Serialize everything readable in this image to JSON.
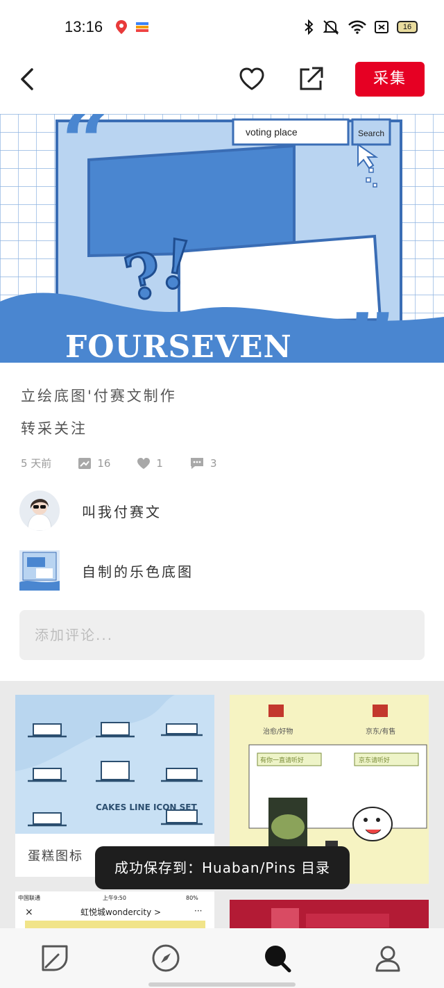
{
  "status_bar": {
    "time": "13:16",
    "battery": "16",
    "icons": [
      "app-notification-icon",
      "wallet-icon",
      "bluetooth-icon",
      "mute-icon",
      "wifi-icon",
      "sim-icon",
      "battery-icon"
    ]
  },
  "top_nav": {
    "collect_label": "采集",
    "icons": [
      "back-arrow-icon",
      "heart-icon",
      "share-icon"
    ]
  },
  "hero": {
    "search_text": "voting place",
    "search_button": "Search",
    "brand_text": "FOURSEVEN"
  },
  "pin": {
    "description_line1": "立绘底图'付赛文制作",
    "description_line2": "转采关注",
    "time_ago": "5 天前",
    "repin_count": "16",
    "like_count": "1",
    "comment_count": "3"
  },
  "user": {
    "name": "叫我付赛文"
  },
  "board": {
    "name": "自制的乐色底图"
  },
  "comment": {
    "placeholder": "添加评论..."
  },
  "related": {
    "card1_caption": "蛋糕图标",
    "card1_title": "CAKES LINE ICON SET",
    "card2_tag_left": "治愈/好物",
    "card2_tag_right": "京东/有售",
    "card2_bubble_left": "有你一直请听好",
    "card2_bubble_right": "京东请听好",
    "card3_carrier": "中国联通",
    "card3_time": "上午9:50",
    "card3_battery": "80%",
    "card3_title": "虹悦城wondercity >"
  },
  "toast": {
    "text": "成功保存到：Huaban/Pins 目录"
  },
  "tab_bar": {
    "icons": [
      "home-leaf-icon",
      "compass-icon",
      "search-icon",
      "profile-icon"
    ]
  },
  "colors": {
    "accent": "#e60023",
    "hero_blue": "#4a86d0",
    "hero_light": "#b9d4f1"
  }
}
